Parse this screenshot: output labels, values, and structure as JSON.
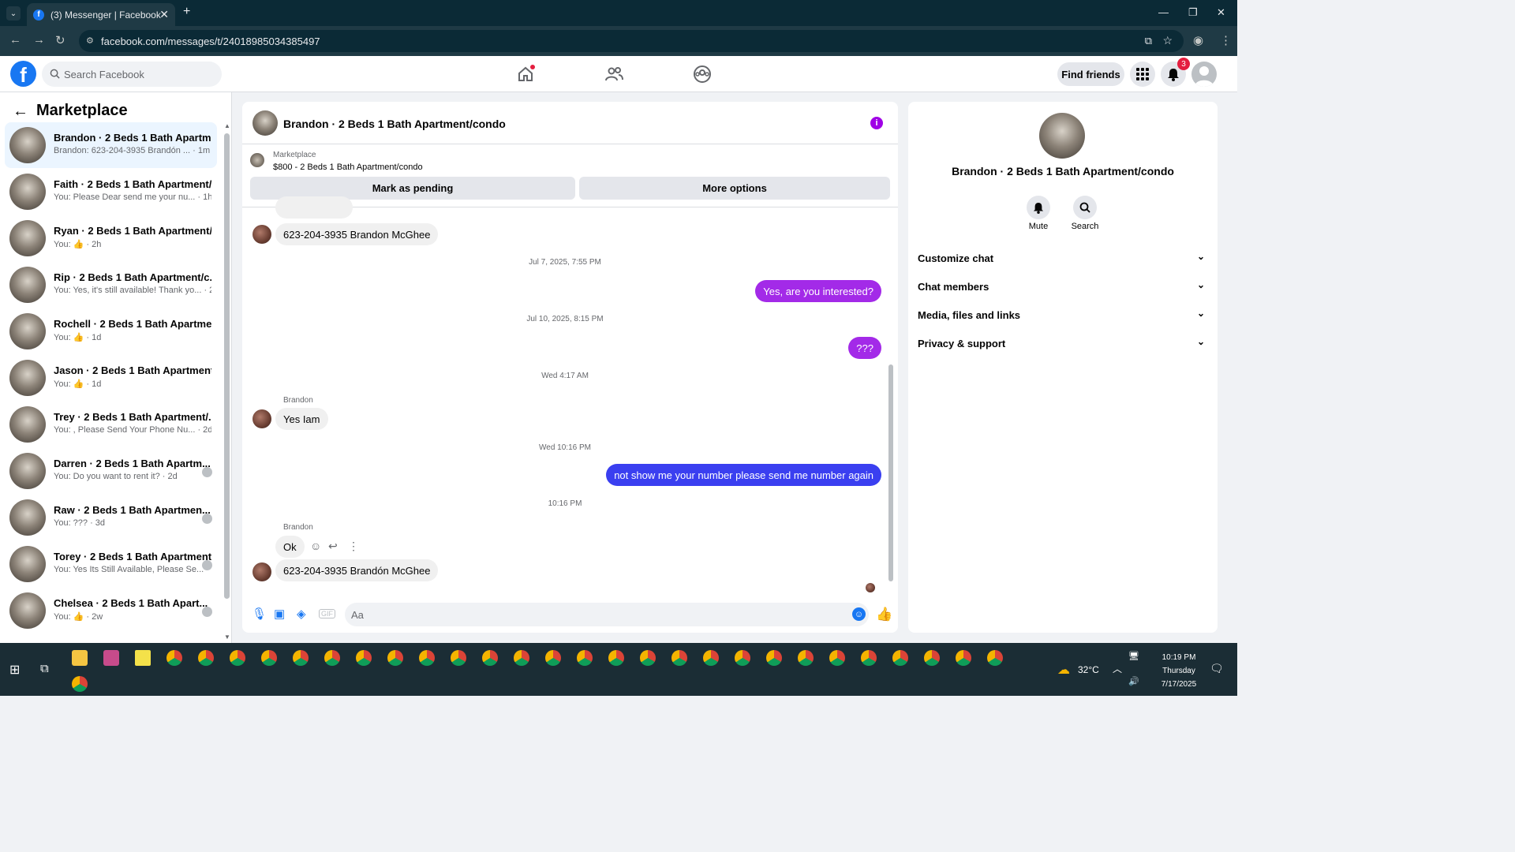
{
  "browser": {
    "tab_title": "(3) Messenger | Facebook",
    "tab_icon": "f",
    "url": "facebook.com/messages/t/24018985034385497"
  },
  "header": {
    "search_placeholder": "Search Facebook",
    "find_friends": "Find friends",
    "notif_count": "3",
    "logo": "f"
  },
  "sidebar": {
    "title": "Marketplace",
    "conversations": [
      {
        "name": "Brandon · 2 Beds 1 Bath Apartm...",
        "preview": "Brandon: 623-204-3935 Brandón ... · 1m",
        "active": true
      },
      {
        "name": "Faith · 2 Beds 1 Bath Apartment/...",
        "preview": "You: Please Dear send me your nu... · 1h"
      },
      {
        "name": "Ryan · 2 Beds 1 Bath Apartment/...",
        "preview": "You: 👍 · 2h"
      },
      {
        "name": "Rip · 2 Beds 1 Bath Apartment/c...",
        "preview": "You: Yes, it's still available! Thank yo... · 2h"
      },
      {
        "name": "Rochell · 2 Beds 1 Bath Apartme...",
        "preview": "You: 👍 · 1d"
      },
      {
        "name": "Jason · 2 Beds 1 Bath Apartment...",
        "preview": "You: 👍 · 1d"
      },
      {
        "name": "Trey · 2 Beds 1 Bath Apartment/...",
        "preview": "You: , Please Send Your Phone Nu... · 2d"
      },
      {
        "name": "Darren · 2 Beds 1 Bath Apartm...",
        "preview": "You: Do you want to rent it? · 2d"
      },
      {
        "name": "Raw · 2 Beds 1 Bath Apartmen...",
        "preview": "You: ??? · 3d"
      },
      {
        "name": "Torey · 2 Beds 1 Bath Apartment...",
        "preview": "You: Yes Its Still Available, Please Se... · 4d"
      },
      {
        "name": "Chelsea · 2 Beds 1 Bath Apart...",
        "preview": "You: 👍 · 2w"
      }
    ]
  },
  "chat": {
    "title": "Brandon · 2 Beds 1 Bath Apartment/condo",
    "marketplace_label": "Marketplace",
    "listing": "$800 - 2 Beds 1 Bath Apartment/condo",
    "mark_pending": "Mark as pending",
    "more_options": "More options",
    "composer_placeholder": "Aa",
    "messages": {
      "m1": "623-204-3935 Brandon McGhee",
      "t1": "Jul 7, 2025, 7:55 PM",
      "m2": "Yes, are you interested?",
      "t2": "Jul 10, 2025, 8:15 PM",
      "m3": "???",
      "t3": "Wed 4:17 AM",
      "s1": "Brandon",
      "m4": "Yes Iam",
      "t4": "Wed 10:16 PM",
      "m5": "not show me your number please send me number again",
      "t5": "10:16 PM",
      "s2": "Brandon",
      "m6": "Ok",
      "m7": "623-204-3935 Brandón McGhee"
    }
  },
  "rightpanel": {
    "name": "Brandon · 2 Beds 1 Bath Apartment/condo",
    "mute": "Mute",
    "search": "Search",
    "rows": [
      "Customize chat",
      "Chat members",
      "Media, files and links",
      "Privacy & support"
    ]
  },
  "taskbar": {
    "temp": "32°C",
    "time": "10:19 PM",
    "day": "Thursday",
    "date": "7/17/2025"
  },
  "colors": {
    "accent": "#1877f2",
    "out_bubble": "#a32ae8",
    "blue_bubble": "#3a3ff0"
  }
}
